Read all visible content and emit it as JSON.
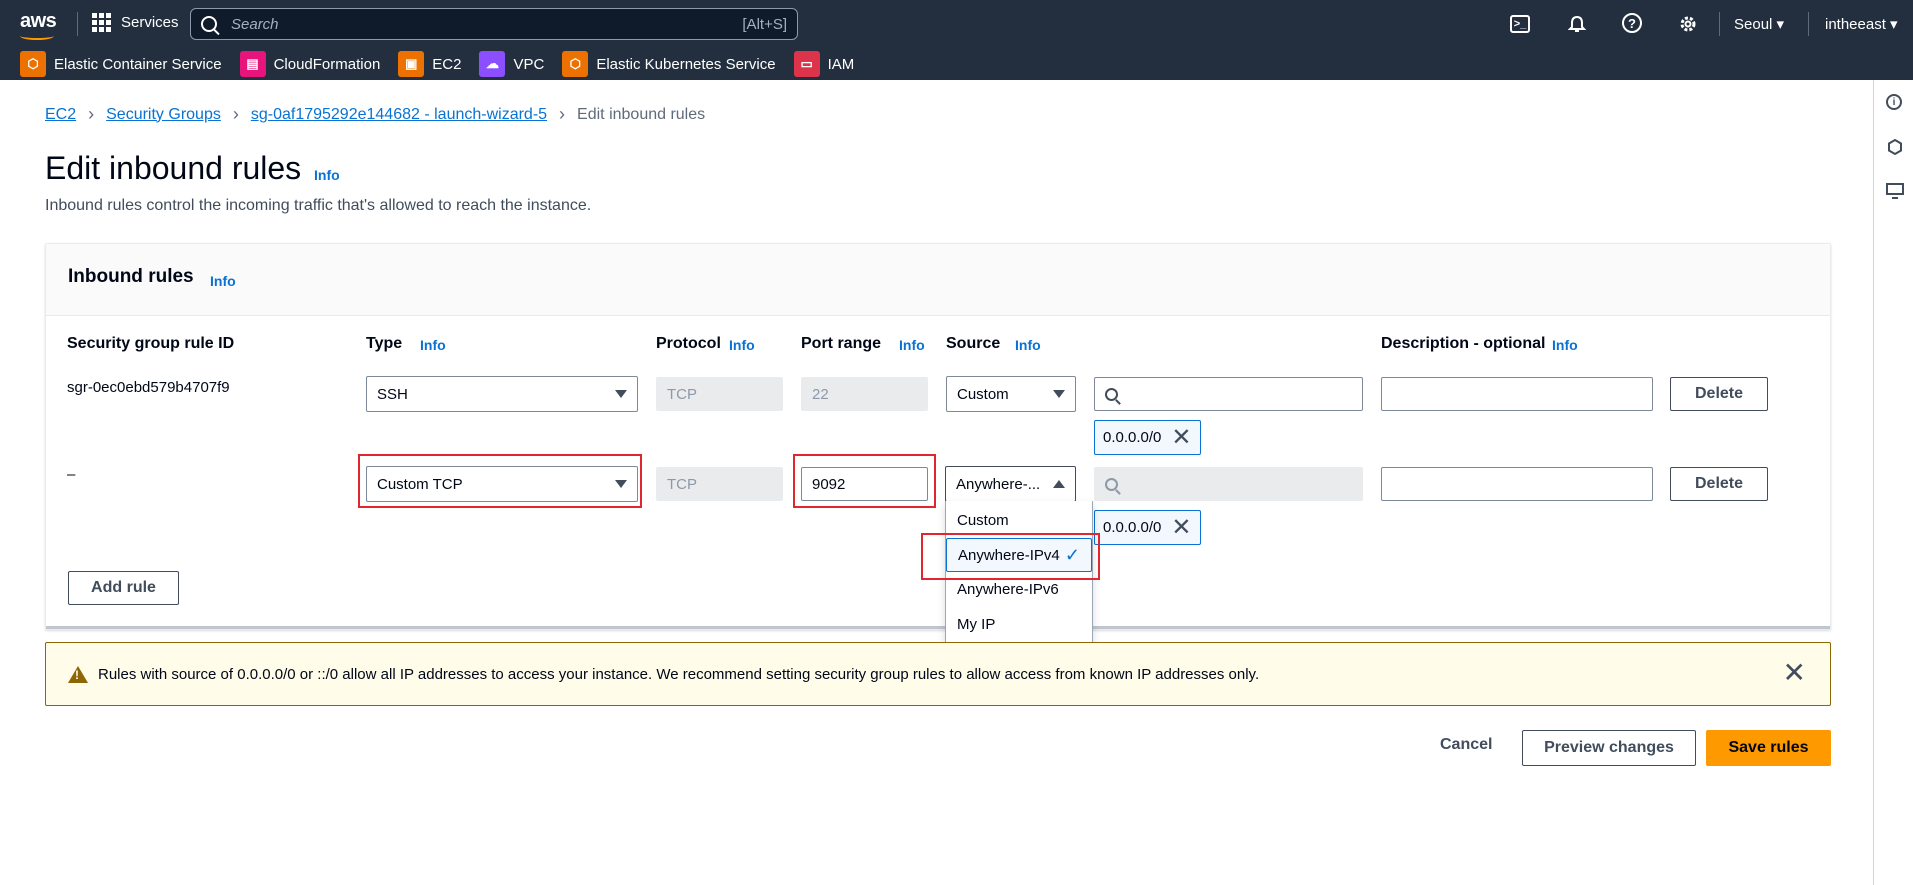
{
  "header": {
    "logo": "aws",
    "services_label": "Services",
    "search_placeholder": "Search",
    "search_shortcut": "[Alt+S]",
    "region": "Seoul ▾",
    "account": "intheeast ▾"
  },
  "favorites": [
    {
      "label": "Elastic Container Service",
      "icon": "ecs-icon",
      "color": "#ed7100"
    },
    {
      "label": "CloudFormation",
      "icon": "cloudformation-icon",
      "color": "#e7157b"
    },
    {
      "label": "EC2",
      "icon": "ec2-icon",
      "color": "#ed7100"
    },
    {
      "label": "VPC",
      "icon": "vpc-icon",
      "color": "#8c4fff"
    },
    {
      "label": "Elastic Kubernetes Service",
      "icon": "eks-icon",
      "color": "#ed7100"
    },
    {
      "label": "IAM",
      "icon": "iam-icon",
      "color": "#dd344c"
    }
  ],
  "breadcrumb": {
    "items": [
      "EC2",
      "Security Groups",
      "sg-0af1795292e144682 - launch-wizard-5"
    ],
    "current": "Edit inbound rules"
  },
  "page": {
    "title": "Edit inbound rules",
    "info": "Info",
    "description": "Inbound rules control the incoming traffic that's allowed to reach the instance."
  },
  "panel": {
    "title": "Inbound rules",
    "info": "Info",
    "columns": {
      "rule_id": "Security group rule ID",
      "type": "Type",
      "protocol": "Protocol",
      "port_range": "Port range",
      "source": "Source",
      "description": "Description - optional",
      "info": "Info"
    },
    "rows": [
      {
        "rule_id": "sgr-0ec0ebd579b4707f9",
        "type": "SSH",
        "protocol": "TCP",
        "port": "22",
        "source": "Custom",
        "token": "0.0.0.0/0",
        "delete": "Delete"
      },
      {
        "rule_id": "–",
        "type": "Custom TCP",
        "protocol": "TCP",
        "port": "9092",
        "source": "Anywhere-...",
        "token": "0.0.0.0/0",
        "delete": "Delete"
      }
    ],
    "add_rule": "Add rule"
  },
  "source_dropdown": {
    "options": [
      "Custom",
      "Anywhere-IPv4",
      "Anywhere-IPv6",
      "My IP"
    ],
    "selected": "Anywhere-IPv4"
  },
  "alert": {
    "text": "Rules with source of 0.0.0.0/0 or ::/0 allow all IP addresses to access your instance. We recommend setting security group rules to allow access from known IP addresses only."
  },
  "footer": {
    "cancel": "Cancel",
    "preview": "Preview changes",
    "save": "Save rules"
  },
  "colors": {
    "nav_bg": "#232f3e",
    "link": "#0972d3",
    "primary_button": "#ff9900",
    "highlight": "#e0262e",
    "alert_bg": "#fffce9"
  }
}
